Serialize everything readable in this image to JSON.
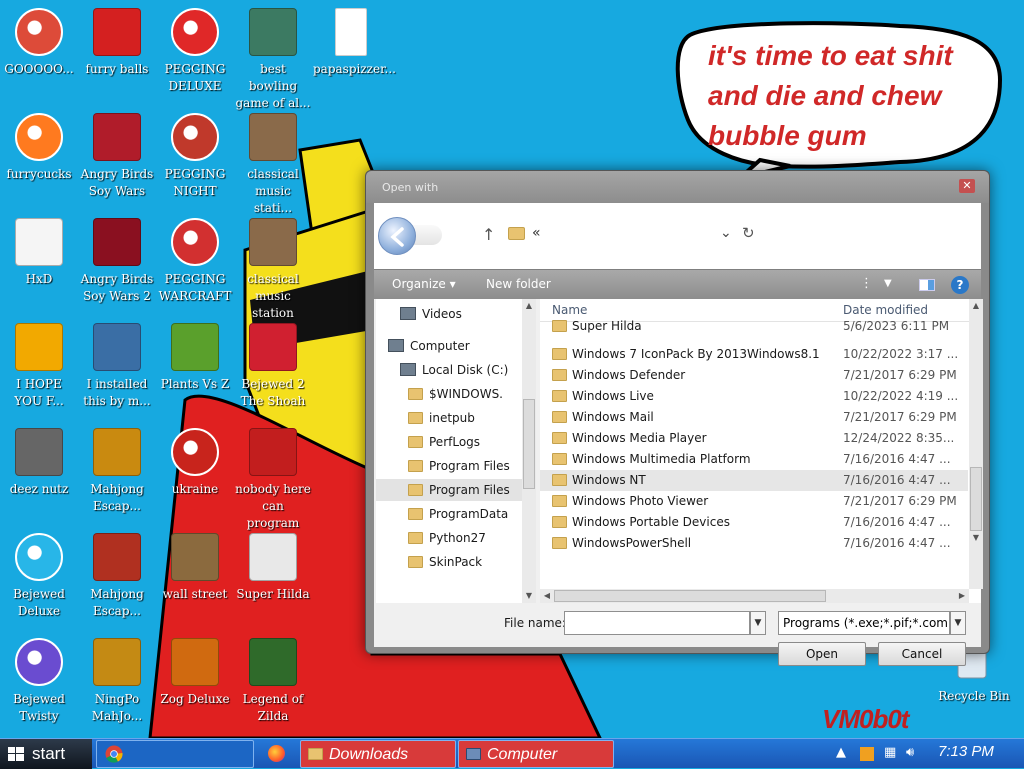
{
  "desktop": {
    "icons": [
      {
        "label": "GOOOOO..."
      },
      {
        "label": "furry balls"
      },
      {
        "label": "PEGGING DELUXE"
      },
      {
        "label": "best bowling game of al..."
      },
      {
        "label": "papaspizzer..."
      },
      {
        "label": "furrycucks"
      },
      {
        "label": "Angry Birds Soy Wars"
      },
      {
        "label": "PEGGING NIGHT"
      },
      {
        "label": "classical music stati..."
      },
      {
        "label": "HxD"
      },
      {
        "label": "Angry Birds Soy Wars 2"
      },
      {
        "label": "PEGGING WARCRAFT"
      },
      {
        "label": "classical music station"
      },
      {
        "label": "I HOPE YOU F..."
      },
      {
        "label": "I installed this by m..."
      },
      {
        "label": "Plants Vs Z"
      },
      {
        "label": "Bejewed 2 The Shoah"
      },
      {
        "label": "deez nutz"
      },
      {
        "label": "Mahjong Escap..."
      },
      {
        "label": "ukraine"
      },
      {
        "label": "nobody here can program"
      },
      {
        "label": "Bejewed Deluxe"
      },
      {
        "label": "Mahjong Escap..."
      },
      {
        "label": "wall street"
      },
      {
        "label": "Super Hilda"
      },
      {
        "label": "Bejewed Twisty"
      },
      {
        "label": "NingPo MahJo..."
      },
      {
        "label": "Zog Deluxe"
      },
      {
        "label": "Legend of Zilda"
      },
      {
        "label": "Recycle Bin"
      }
    ],
    "bubble_text": "it's time to eat shit and die and chew bubble gum",
    "signature": "VM0b0t"
  },
  "dialog": {
    "title": "Open with",
    "close_label": "✕",
    "toolbar": {
      "organize": "Organize ▾",
      "new_folder": "New folder",
      "help": "?"
    },
    "path_chevron": "«",
    "tree": [
      {
        "label": "Videos",
        "icon": "video-library-icon"
      },
      {
        "label": "Computer",
        "icon": "computer-icon"
      },
      {
        "label": "Local Disk (C:)",
        "icon": "drive-icon"
      },
      {
        "label": "$WINDOWS.",
        "icon": "folder-icon"
      },
      {
        "label": "inetpub",
        "icon": "folder-icon"
      },
      {
        "label": "PerfLogs",
        "icon": "folder-icon"
      },
      {
        "label": "Program Files",
        "icon": "folder-icon"
      },
      {
        "label": "Program Files",
        "icon": "folder-icon",
        "selected": true
      },
      {
        "label": "ProgramData",
        "icon": "folder-icon"
      },
      {
        "label": "Python27",
        "icon": "folder-icon"
      },
      {
        "label": "SkinPack",
        "icon": "folder-icon"
      }
    ],
    "columns": {
      "name": "Name",
      "date": "Date modified"
    },
    "files": [
      {
        "name": "Super Hilda",
        "date": "5/6/2023 6:11 PM"
      },
      {
        "name": "Windows 7 IconPack By 2013Windows8.1",
        "date": "10/22/2022 3:17 ..."
      },
      {
        "name": "Windows Defender",
        "date": "7/21/2017 6:29 PM"
      },
      {
        "name": "Windows Live",
        "date": "10/22/2022 4:19 ..."
      },
      {
        "name": "Windows Mail",
        "date": "7/21/2017 6:29 PM"
      },
      {
        "name": "Windows Media Player",
        "date": "12/24/2022 8:35..."
      },
      {
        "name": "Windows Multimedia Platform",
        "date": "7/16/2016 4:47 ..."
      },
      {
        "name": "Windows NT",
        "date": "7/16/2016 4:47 ...",
        "selected": true
      },
      {
        "name": "Windows Photo Viewer",
        "date": "7/21/2017 6:29 PM"
      },
      {
        "name": "Windows Portable Devices",
        "date": "7/16/2016 4:47 ..."
      },
      {
        "name": "WindowsPowerShell",
        "date": "7/16/2016 4:47 ..."
      }
    ],
    "file_name_label": "File name:",
    "file_name_value": "",
    "filter_value": "Programs (*.exe;*.pif;*.com;*.b",
    "open_button": "Open",
    "cancel_button": "Cancel"
  },
  "taskbar": {
    "start": "start",
    "buttons": [
      {
        "label": "Downloads"
      },
      {
        "label": "Computer"
      }
    ],
    "clock": "7:13 PM"
  }
}
